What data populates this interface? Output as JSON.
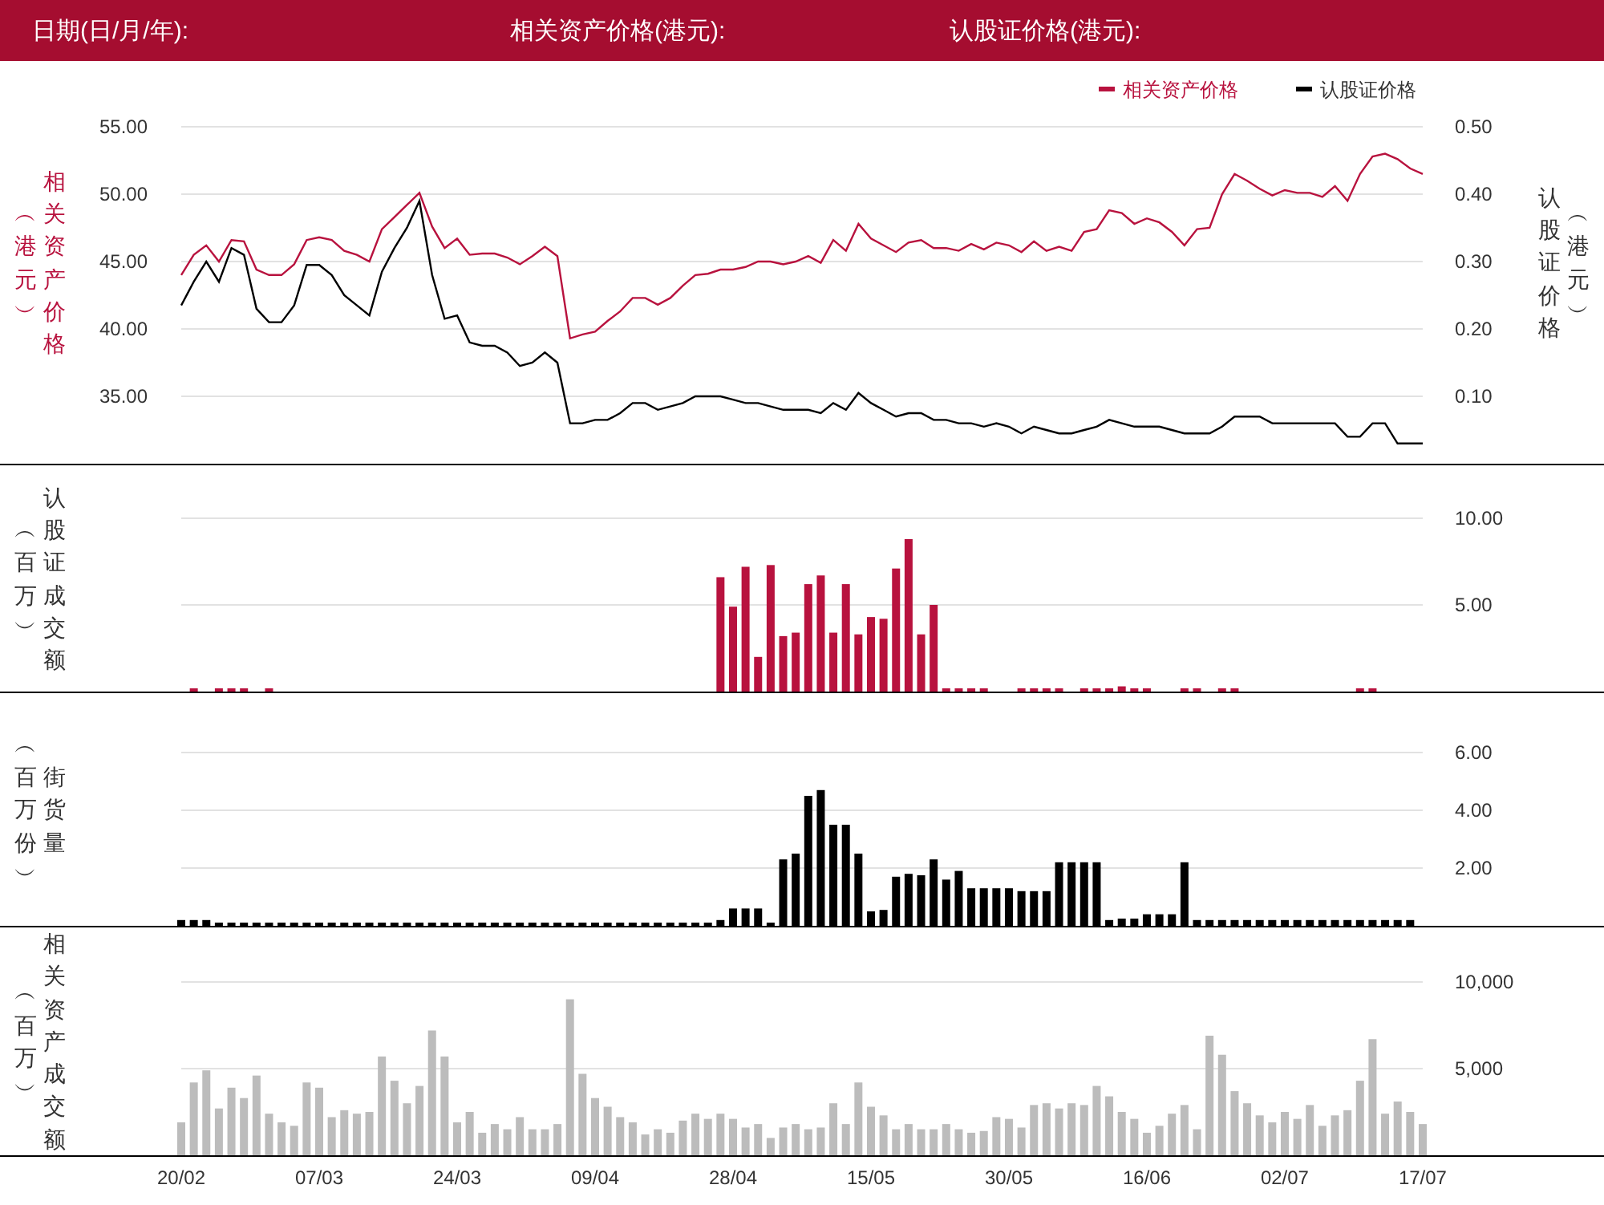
{
  "header": {
    "fields": [
      {
        "label": "日期(日/月/年):"
      },
      {
        "label": "相关资产价格(港元):"
      },
      {
        "label": "认股证价格(港元):"
      }
    ]
  },
  "panels": [
    {
      "title": "相关资产价格",
      "unit": "︵港元︶",
      "right_title": "认股证价格",
      "right_unit": "︵港元︶",
      "chart_data": {
        "type": "line",
        "grid": true,
        "legend": true,
        "ylim": [
          30,
          55
        ],
        "yticks": [
          {
            "value": 35,
            "label": "35.00"
          },
          {
            "value": 40,
            "label": "40.00"
          },
          {
            "value": 45,
            "label": "45.00"
          },
          {
            "value": 50,
            "label": "50.00"
          },
          {
            "value": 55,
            "label": "55.00"
          }
        ],
        "y2lim": [
          0,
          0.5
        ],
        "y2ticks": [
          {
            "value": 0.1,
            "label": "0.10"
          },
          {
            "value": 0.2,
            "label": "0.20"
          },
          {
            "value": 0.3,
            "label": "0.30"
          },
          {
            "value": 0.4,
            "label": "0.40"
          },
          {
            "value": 0.5,
            "label": "0.50"
          }
        ],
        "series": [
          {
            "name": "相关资产价格",
            "color": "#b8123e",
            "values": [
              44,
              45.5,
              46.2,
              45,
              46.6,
              46.5,
              44.4,
              44,
              44,
              44.8,
              46.6,
              46.8,
              46.6,
              45.8,
              45.5,
              45,
              47.4,
              48.3,
              49.2,
              50.1,
              47.6,
              46,
              46.7,
              45.5,
              45.6,
              45.6,
              45.3,
              44.8,
              45.4,
              46.1,
              45.4,
              39.3,
              39.6,
              39.8,
              40.6,
              41.3,
              42.3,
              42.3,
              41.8,
              42.3,
              43.2,
              44,
              44.1,
              44.4,
              44.4,
              44.6,
              45,
              45,
              44.8,
              45,
              45.4,
              44.9,
              46.6,
              45.8,
              47.8,
              46.7,
              46.2,
              45.7,
              46.4,
              46.6,
              46,
              46,
              45.8,
              46.3,
              45.9,
              46.4,
              46.2,
              45.7,
              46.5,
              45.8,
              46.1,
              45.8,
              47.2,
              47.4,
              48.8,
              48.6,
              47.8,
              48.2,
              47.9,
              47.2,
              46.2,
              47.4,
              47.5,
              50,
              51.5,
              51,
              50.4,
              49.9,
              50.3,
              50.1,
              50.1,
              49.8,
              50.6,
              49.5,
              51.5,
              52.8,
              53,
              52.6,
              51.9,
              51.5
            ]
          },
          {
            "name": "认股证价格",
            "color": "#000000",
            "axis": "y2",
            "values": [
              0.235,
              0.27,
              0.3,
              0.27,
              0.32,
              0.31,
              0.23,
              0.21,
              0.21,
              0.235,
              0.295,
              0.295,
              0.28,
              0.25,
              0.235,
              0.22,
              0.285,
              0.32,
              0.35,
              0.39,
              0.28,
              0.215,
              0.22,
              0.18,
              0.175,
              0.175,
              0.165,
              0.145,
              0.15,
              0.165,
              0.15,
              0.06,
              0.06,
              0.065,
              0.065,
              0.075,
              0.09,
              0.09,
              0.08,
              0.085,
              0.09,
              0.1,
              0.1,
              0.1,
              0.095,
              0.09,
              0.09,
              0.085,
              0.08,
              0.08,
              0.08,
              0.075,
              0.09,
              0.08,
              0.105,
              0.09,
              0.08,
              0.07,
              0.075,
              0.075,
              0.065,
              0.065,
              0.06,
              0.06,
              0.055,
              0.06,
              0.055,
              0.045,
              0.055,
              0.05,
              0.045,
              0.045,
              0.05,
              0.055,
              0.065,
              0.06,
              0.055,
              0.055,
              0.055,
              0.05,
              0.045,
              0.045,
              0.045,
              0.055,
              0.07,
              0.07,
              0.07,
              0.06,
              0.06,
              0.06,
              0.06,
              0.06,
              0.06,
              0.04,
              0.04,
              0.06,
              0.06,
              0.03,
              0.03,
              0.03
            ]
          }
        ]
      }
    },
    {
      "unit": "︵百万︶",
      "chart_data": {
        "type": "bar",
        "grid": true,
        "ylim": [
          0,
          10
        ],
        "yticks": [
          {
            "value": 5,
            "label": "5.00"
          },
          {
            "value": 10,
            "label": "10.00"
          }
        ],
        "series": [
          {
            "name": "认股证成交额",
            "color": "#b8123e",
            "values": [
              null,
              0.1,
              null,
              0.1,
              0.1,
              0.1,
              null,
              0.1,
              null,
              null,
              null,
              null,
              null,
              null,
              null,
              null,
              null,
              null,
              null,
              null,
              null,
              null,
              null,
              null,
              null,
              null,
              null,
              null,
              null,
              null,
              null,
              null,
              null,
              null,
              null,
              null,
              null,
              null,
              null,
              null,
              null,
              null,
              null,
              6.6,
              4.9,
              7.2,
              2.0,
              7.3,
              3.2,
              3.4,
              6.2,
              6.7,
              3.4,
              6.2,
              3.3,
              4.3,
              4.2,
              7.1,
              8.8,
              3.3,
              5.0,
              0.1,
              0.1,
              0.1,
              0.1,
              null,
              null,
              0.1,
              0.1,
              0.1,
              0.1,
              null,
              0.1,
              0.1,
              0.1,
              0.3,
              0.1,
              0.1,
              null,
              null,
              0.1,
              0.1,
              null,
              0.1,
              0.1,
              null,
              null,
              null,
              null,
              null,
              null,
              null,
              null,
              null,
              0.1,
              0.1,
              null,
              null,
              null,
              null
            ]
          }
        ]
      }
    },
    {
      "unit": "︵百万份︶",
      "chart_data": {
        "type": "bar",
        "grid": true,
        "ylim": [
          0,
          6
        ],
        "yticks": [
          {
            "value": 2,
            "label": "2.00"
          },
          {
            "value": 4,
            "label": "4.00"
          },
          {
            "value": 6,
            "label": "6.00"
          }
        ],
        "series": [
          {
            "name": "街货量",
            "color": "#000000",
            "values": [
              0.2,
              0.2,
              0.2,
              0.1,
              0.1,
              0.1,
              0.05,
              0.05,
              0.05,
              0.05,
              0.05,
              0.05,
              0.05,
              0.05,
              0.05,
              0.05,
              0.05,
              0.05,
              0.05,
              0.05,
              0.05,
              0.05,
              0.05,
              0.05,
              0.05,
              0.05,
              0.05,
              0.05,
              0.05,
              0.05,
              0.05,
              0.05,
              0.05,
              0.05,
              0.05,
              0.05,
              0.05,
              0.05,
              0.05,
              0.05,
              0.05,
              0.05,
              0.05,
              0.2,
              0.6,
              0.6,
              0.6,
              0.1,
              2.3,
              2.5,
              4.5,
              4.7,
              3.5,
              3.5,
              2.5,
              0.5,
              0.55,
              1.7,
              1.8,
              1.75,
              2.3,
              1.6,
              1.9,
              1.3,
              1.3,
              1.3,
              1.3,
              1.2,
              1.2,
              1.2,
              2.2,
              2.2,
              2.2,
              2.2,
              0.2,
              0.25,
              0.25,
              0.4,
              0.4,
              0.4,
              2.2,
              0.2,
              0.2,
              0.2,
              0.2,
              0.2,
              0.2,
              0.2,
              0.2,
              0.2,
              0.2,
              0.2,
              0.2,
              0.2,
              0.2,
              0.2,
              0.2,
              0.2,
              0.2,
              null
            ]
          }
        ]
      }
    },
    {
      "unit": "︵百万︶",
      "chart_data": {
        "type": "bar",
        "grid": true,
        "ylim": [
          0,
          10000
        ],
        "yticks": [
          {
            "value": 5000,
            "label": "5,000"
          },
          {
            "value": 10000,
            "label": "10,000"
          }
        ],
        "categories": [
          "20/02",
          null,
          null,
          null,
          null,
          null,
          null,
          null,
          null,
          null,
          null,
          "07/03",
          null,
          null,
          null,
          null,
          null,
          null,
          null,
          null,
          null,
          null,
          "24/03",
          null,
          null,
          null,
          null,
          null,
          null,
          null,
          null,
          null,
          null,
          "09/04",
          null,
          null,
          null,
          null,
          null,
          null,
          null,
          null,
          null,
          null,
          "28/04",
          null,
          null,
          null,
          null,
          null,
          null,
          null,
          null,
          null,
          null,
          "15/05",
          null,
          null,
          null,
          null,
          null,
          null,
          null,
          null,
          null,
          null,
          "30/05",
          null,
          null,
          null,
          null,
          null,
          null,
          null,
          null,
          null,
          null,
          "16/06",
          null,
          null,
          null,
          null,
          null,
          null,
          null,
          null,
          null,
          null,
          "02/07",
          null,
          null,
          null,
          null,
          null,
          null,
          null,
          null,
          null,
          null,
          "17/07"
        ],
        "series": [
          {
            "name": "相关资产成交额",
            "color": "#bcbcbc",
            "values": [
              1900,
              4200,
              4900,
              2700,
              3900,
              3300,
              4600,
              2400,
              1900,
              1700,
              4200,
              3900,
              2200,
              2600,
              2400,
              2500,
              5700,
              4300,
              3000,
              4000,
              7200,
              5700,
              1900,
              2500,
              1300,
              1800,
              1500,
              2200,
              1500,
              1500,
              1800,
              9000,
              4700,
              3300,
              2800,
              2200,
              1900,
              1200,
              1500,
              1300,
              2000,
              2400,
              2100,
              2400,
              2100,
              1600,
              1800,
              1000,
              1600,
              1800,
              1500,
              1600,
              3000,
              1800,
              4200,
              2800,
              2300,
              1500,
              1800,
              1500,
              1500,
              1800,
              1500,
              1300,
              1400,
              2200,
              2100,
              1600,
              2900,
              3000,
              2700,
              3000,
              2900,
              4000,
              3400,
              2500,
              2100,
              1300,
              1700,
              2400,
              2900,
              1500,
              6900,
              5800,
              3700,
              3000,
              2300,
              1900,
              2500,
              2100,
              2900,
              1700,
              2300,
              2600,
              4300,
              6700,
              2400,
              3100,
              2500,
              1800
            ]
          }
        ]
      }
    }
  ]
}
